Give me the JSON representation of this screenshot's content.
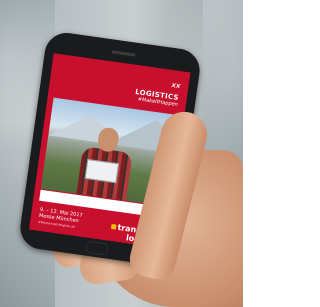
{
  "screen": {
    "brand_mark": "xx",
    "headline_1": "LOGISTICS",
    "headline_2": "#MakeItHappen",
    "partner_logos": [
      "",
      "",
      "",
      ""
    ],
    "dates": "9. – 12. Mai 2017",
    "venue": "Messe München",
    "logo_main": "transport",
    "logo_sub": "logistic",
    "url": "www.transportlogistic.de"
  },
  "colors": {
    "screen_bg": "#c8102e",
    "logo_accent": "#f2c200"
  }
}
